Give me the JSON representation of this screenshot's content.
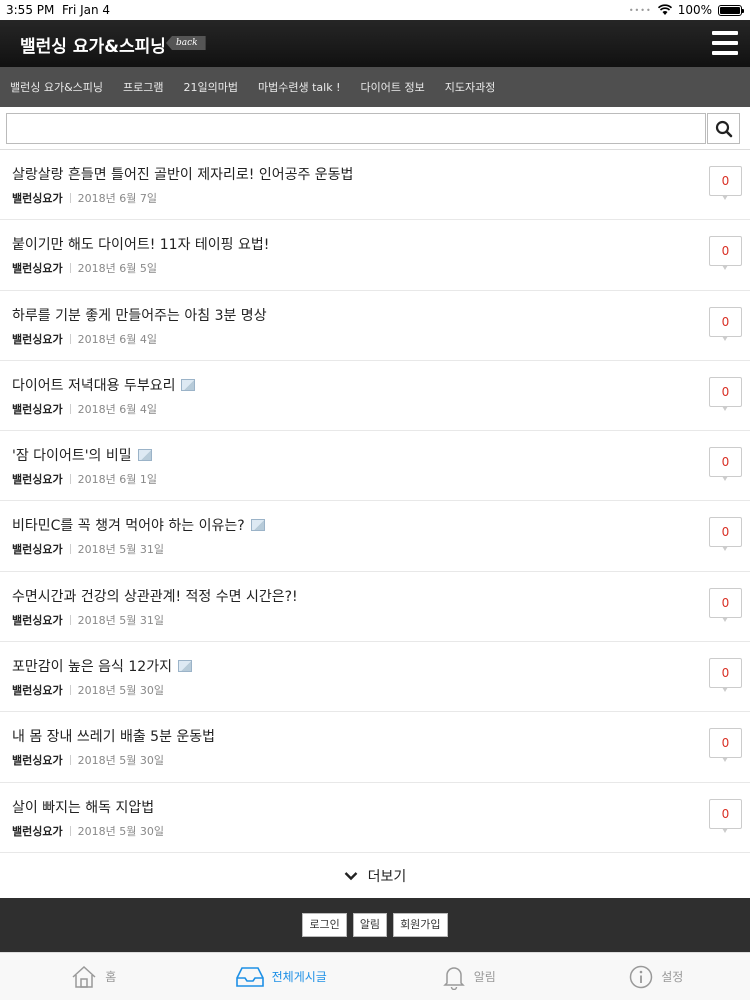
{
  "status": {
    "time": "3:55 PM",
    "date": "Fri Jan 4",
    "battery": "100%",
    "signal": "••••"
  },
  "header": {
    "title": "밸런싱 요가&스피닝",
    "back": "back"
  },
  "nav": [
    "밸런싱 요가&스피닝",
    "프로그램",
    "21일의마법",
    "마법수련생 talk !",
    "다이어트 정보",
    "지도자과정"
  ],
  "search": {
    "value": "",
    "placeholder": ""
  },
  "posts": [
    {
      "title": "살랑살랑 흔들면 틀어진 골반이 제자리로! 인어공주 운동법",
      "author": "밸런싱요가",
      "date": "2018년 6월 7일",
      "comments": "0"
    },
    {
      "title": "붙이기만 해도 다이어트! 11자 테이핑 요법!",
      "author": "밸런싱요가",
      "date": "2018년 6월 5일",
      "comments": "0"
    },
    {
      "title": "하루를 기분 좋게 만들어주는 아침 3분 명상",
      "author": "밸런싱요가",
      "date": "2018년 6월 4일",
      "comments": "0"
    },
    {
      "title": "다이어트 저녁대용 두부요리",
      "author": "밸런싱요가",
      "date": "2018년 6월 4일",
      "comments": "0"
    },
    {
      "title": "'잠 다이어트'의 비밀",
      "author": "밸런싱요가",
      "date": "2018년 6월 1일",
      "comments": "0"
    },
    {
      "title": "비타민C를 꼭 챙겨 먹어야 하는 이유는?",
      "author": "밸런싱요가",
      "date": "2018년 5월 31일",
      "comments": "0"
    },
    {
      "title": "수면시간과 건강의 상관관계! 적정 수면 시간은?!",
      "author": "밸런싱요가",
      "date": "2018년 5월 31일",
      "comments": "0"
    },
    {
      "title": "포만감이 높은 음식 12가지",
      "author": "밸런싱요가",
      "date": "2018년 5월 30일",
      "comments": "0"
    },
    {
      "title": "내 몸 장내 쓰레기 배출 5분 운동법",
      "author": "밸런싱요가",
      "date": "2018년 5월 30일",
      "comments": "0"
    },
    {
      "title": "살이 빠지는 해독 지압법",
      "author": "밸런싱요가",
      "date": "2018년 5월 30일",
      "comments": "0"
    }
  ],
  "more": "더보기",
  "footer": {
    "login": "로그인",
    "alerts": "알림",
    "signup": "회원가입"
  },
  "tabs": {
    "home": "홈",
    "all": "전체게시글",
    "alerts": "알림",
    "settings": "설정"
  },
  "colors": {
    "accent": "#1e90e6",
    "comment": "#d93025",
    "header": "#1a1a1a",
    "nav": "#4f4f4f",
    "footer": "#2f2f2f"
  }
}
